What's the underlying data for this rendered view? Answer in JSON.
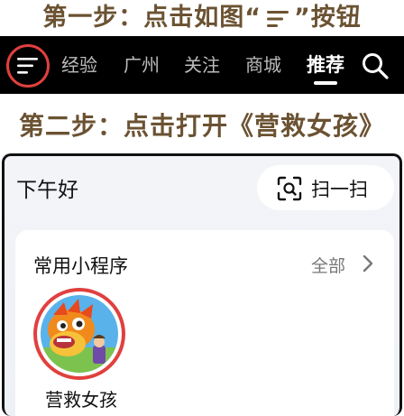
{
  "step1": {
    "prefix": "第一步：点击如图“",
    "suffix": "”按钮"
  },
  "step2": {
    "text": "第二步：点击打开《营救女孩》"
  },
  "navbar": {
    "tabs": [
      {
        "label": "经验"
      },
      {
        "label": "广州"
      },
      {
        "label": "关注"
      },
      {
        "label": "商城"
      },
      {
        "label": "推荐",
        "active": true
      }
    ]
  },
  "panel": {
    "greeting": "下午好",
    "scan_label": "扫一扫",
    "card": {
      "title": "常用小程序",
      "all_label": "全部",
      "apps": [
        {
          "label": "营救女孩"
        }
      ]
    }
  },
  "colors": {
    "title_brown": "#6b5232",
    "highlight_red": "#e0403e",
    "navbar_bg": "#000000"
  },
  "icons": [
    "menu-icon",
    "search-icon",
    "scan-icon",
    "chevron-right-icon",
    "app-icon"
  ]
}
